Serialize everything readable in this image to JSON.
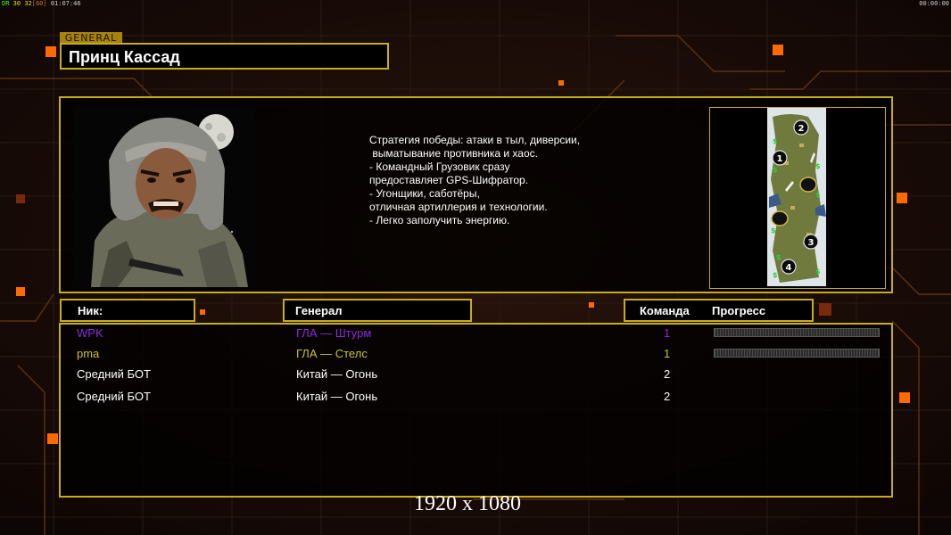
{
  "hud": {
    "debug_prefix": "DR",
    "debug_a": "30",
    "debug_b": "32",
    "debug_c": "[60]",
    "clock_left": "01:07:46",
    "clock_right": "00:00:00"
  },
  "general": {
    "tag": "GENERAL",
    "name": "Принц Кассад",
    "description": [
      "Стратегия победы: атаки в тыл, диверсии,",
      " выматывание противника и хаос.",
      "",
      "- Командный Грузовик сразу",
      "предоставляет GPS-Шифратор.",
      "",
      "- Угонщики, саботёры,",
      "отличная артиллерия и технологии.",
      "",
      "- Легко заполучить энергию."
    ]
  },
  "map": {
    "start_positions": [
      "1",
      "2",
      "3",
      "4"
    ]
  },
  "table_headers": {
    "nick": "Ник:",
    "general": "Генерал",
    "team": "Команда",
    "progress": "Прогресс"
  },
  "players": [
    {
      "nick": "WPK",
      "general": "ГЛА — Штурм",
      "team": "1",
      "color": "#8a2be2",
      "progress": 0
    },
    {
      "nick": "pma",
      "general": "ГЛА — Стелс",
      "team": "1",
      "color": "#c9c62a",
      "progress": 0
    },
    {
      "nick": "Средний БОТ",
      "general": "Китай — Огонь",
      "team": "2",
      "color": "#ffffff"
    },
    {
      "nick": "Средний БОТ",
      "general": "Китай — Огонь",
      "team": "2",
      "color": "#ffffff"
    }
  ],
  "resolution_label": "1920 x 1080",
  "colors": {
    "accent_border": "#c8ad1b",
    "circuit_orange": "#ff6a00",
    "background": "#120806"
  }
}
